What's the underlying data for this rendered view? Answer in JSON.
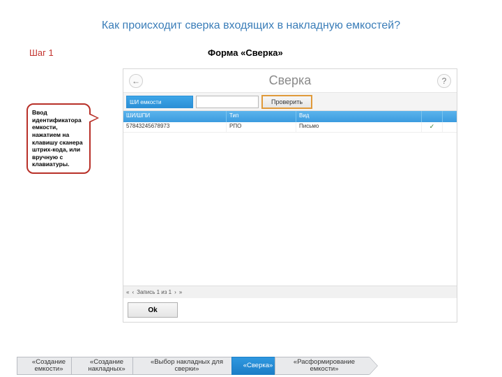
{
  "slide": {
    "title": "Как происходит сверка входящих в накладную емкостей?",
    "step_label": "Шаг 1",
    "form_title": "Форма «Сверка»"
  },
  "callout": {
    "text": "Ввод идентификатора емкости, нажатием на клавишу сканера штрих-кода, или вручную с клавиатуры."
  },
  "app": {
    "back_icon": "←",
    "help_icon": "?",
    "title": "Сверка",
    "id_label": "ШИ емкости",
    "verify_label": "Проверить",
    "columns": {
      "c1": "ШИ/ШПИ",
      "c2": "Тип",
      "c3": "Вид",
      "c4": ""
    },
    "row": {
      "c1": "57843245678973",
      "c2": "РПО",
      "c3": "Письмо",
      "c4": "✓"
    },
    "footer_nav": {
      "first": "«",
      "prev": "‹",
      "label": "Запись 1 из 1",
      "next": "›",
      "last": "»"
    },
    "ok_label": "Ok"
  },
  "steps": {
    "s1": "«Создание емкости»",
    "s2": "«Создание накладных»",
    "s3": "«Выбор накладных для сверки»",
    "s4": "«Сверка»",
    "s5": "«Расформирование емкости»"
  }
}
